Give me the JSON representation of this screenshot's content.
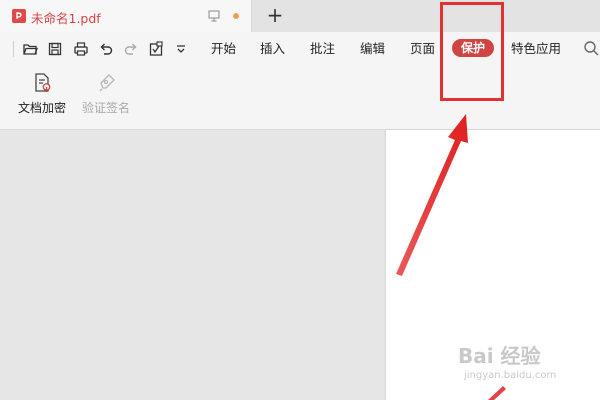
{
  "tab": {
    "title": "未命名1.pdf",
    "new_tab_label": "+"
  },
  "quick_access": {
    "icons": [
      "open-folder-icon",
      "save-icon",
      "print-icon",
      "undo-icon",
      "redo-icon",
      "export-icon",
      "dropdown-chevron-icon"
    ]
  },
  "menu": {
    "tabs": [
      {
        "label": "开始"
      },
      {
        "label": "插入"
      },
      {
        "label": "批注"
      },
      {
        "label": "编辑"
      },
      {
        "label": "页面"
      },
      {
        "label": "保护",
        "active": true
      },
      {
        "label": "特色应用"
      }
    ]
  },
  "ribbon": {
    "encrypt_label": "文档加密",
    "verify_label": "验证签名"
  },
  "watermark": {
    "brand": "Bai 经验",
    "url": "jingyan.baidu.com"
  },
  "colors": {
    "accent": "#d14444",
    "annotation": "#e23131"
  }
}
